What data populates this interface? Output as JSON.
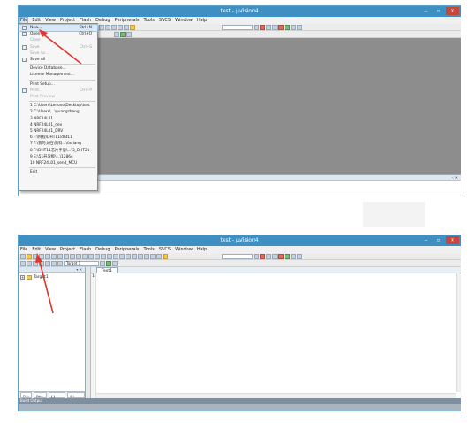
{
  "window1": {
    "title": "test - µVision4",
    "menu": [
      "File",
      "Edit",
      "View",
      "Project",
      "Flash",
      "Debug",
      "Peripherals",
      "Tools",
      "SVCS",
      "Window",
      "Help"
    ],
    "file_menu": [
      {
        "label": "New...",
        "shortcut": "Ctrl+N",
        "highlight": true,
        "icon": "new-file-icon"
      },
      {
        "label": "Open",
        "shortcut": "Ctrl+O",
        "icon": "open-folder-icon"
      },
      {
        "label": "Close",
        "disabled": true
      },
      {
        "label": "Save",
        "shortcut": "Ctrl+S",
        "disabled": true,
        "icon": "save-icon"
      },
      {
        "label": "Save As...",
        "disabled": true
      },
      {
        "label": "Save All",
        "icon": "save-all-icon"
      },
      {
        "sep": true
      },
      {
        "label": "Device Database..."
      },
      {
        "label": "License Management..."
      },
      {
        "sep": true
      },
      {
        "label": "Print Setup..."
      },
      {
        "label": "Print...",
        "shortcut": "Ctrl+P",
        "disabled": true,
        "icon": "print-icon"
      },
      {
        "label": "Print Preview",
        "disabled": true
      },
      {
        "sep": true
      },
      {
        "label": "1 C:\\Users\\Lenovo\\Desktop\\test"
      },
      {
        "label": "2 C:\\Users\\...\\guangzhang"
      },
      {
        "label": "3 NRF24L01"
      },
      {
        "label": "4 NRF24L01_dev"
      },
      {
        "label": "5 NRF24L01_DRV"
      },
      {
        "label": "6 F:\\例程\\DHT11\\dht11"
      },
      {
        "label": "7 F:\\我的文档\\资料...\\faxiang"
      },
      {
        "label": "8 F:\\DHT11芯片手册\\...\\3_DHT21"
      },
      {
        "label": "9 E:\\51开发板\\...\\12864"
      },
      {
        "label": "10 NRF24L01_send_MCU"
      },
      {
        "sep": true
      },
      {
        "label": "Exit"
      }
    ]
  },
  "window2": {
    "title": "test - µVision4",
    "menu": [
      "File",
      "Edit",
      "View",
      "Project",
      "Flash",
      "Debug",
      "Peripherals",
      "Tools",
      "SVCS",
      "Window",
      "Help"
    ],
    "target_select": "Target 1",
    "project_tree_root": "Target1",
    "project_tabs": [
      "Pr...",
      "Bo...",
      "{} Fu...",
      "0+ Te..."
    ],
    "editor_tab": "Text1",
    "line_number": "1",
    "build_output_label": "Build Output"
  },
  "colors": {
    "title_bar": "#3e8fc2",
    "workspace": "#8d8d8d",
    "arrow": "#e0362b"
  }
}
